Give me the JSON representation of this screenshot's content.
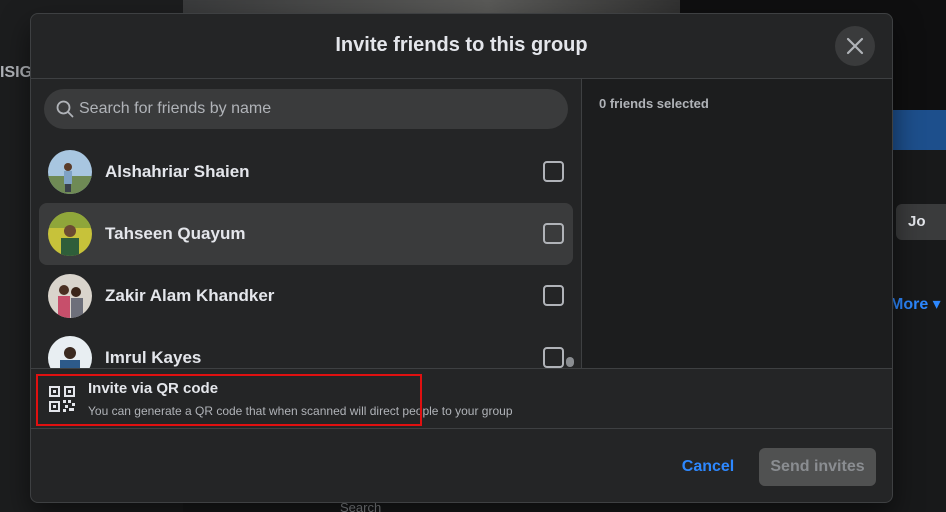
{
  "background": {
    "left_text": "ISIG",
    "join_label": "Jo",
    "more_label": "More",
    "search_label": "Search"
  },
  "modal": {
    "title": "Invite friends to this group",
    "close_icon": "close-icon",
    "search": {
      "placeholder": "Search for friends by name",
      "value": "",
      "icon": "search-icon"
    },
    "selected_count": "0 friends selected",
    "friends": [
      {
        "name": "Alshahriar Shaien",
        "checked": false
      },
      {
        "name": "Tahseen Quayum",
        "checked": false
      },
      {
        "name": "Zakir Alam Khandker",
        "checked": false
      },
      {
        "name": "Imrul Kayes",
        "checked": false
      }
    ],
    "qr": {
      "title": "Invite via QR code",
      "description": "You can generate a QR code that when scanned will direct people to your group",
      "icon": "qr-code-icon"
    },
    "cancel_label": "Cancel",
    "send_label": "Send invites"
  },
  "colors": {
    "accent": "#2d88ff",
    "highlight": "#e01010",
    "surface": "#242526"
  }
}
